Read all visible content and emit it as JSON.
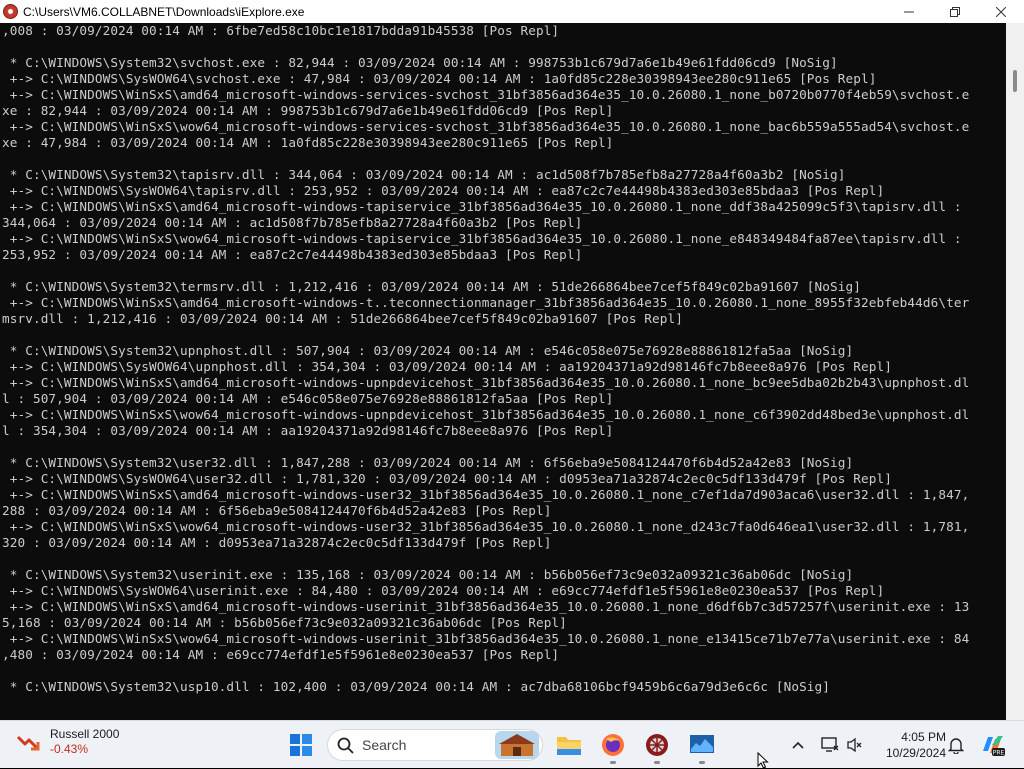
{
  "window": {
    "title": "C:\\Users\\VM6.COLLABNET\\Downloads\\iExplore.exe",
    "icons": {
      "app": "app-icon",
      "minimize": "minimize-icon",
      "maximize": "maximize-icon",
      "close": "close-icon"
    }
  },
  "console": {
    "lines": [
      ",008 : 03/09/2024 00:14 AM : 6fbe7ed58c10bc1e1817bdda91b45538 [Pos Repl]",
      "",
      " * C:\\WINDOWS\\System32\\svchost.exe : 82,944 : 03/09/2024 00:14 AM : 998753b1c679d7a6e1b49e61fdd06cd9 [NoSig]",
      " +-> C:\\WINDOWS\\SysWOW64\\svchost.exe : 47,984 : 03/09/2024 00:14 AM : 1a0fd85c228e30398943ee280c911e65 [Pos Repl]",
      " +-> C:\\WINDOWS\\WinSxS\\amd64_microsoft-windows-services-svchost_31bf3856ad364e35_10.0.26080.1_none_b0720b0770f4eb59\\svchost.e",
      "xe : 82,944 : 03/09/2024 00:14 AM : 998753b1c679d7a6e1b49e61fdd06cd9 [Pos Repl]",
      " +-> C:\\WINDOWS\\WinSxS\\wow64_microsoft-windows-services-svchost_31bf3856ad364e35_10.0.26080.1_none_bac6b559a555ad54\\svchost.e",
      "xe : 47,984 : 03/09/2024 00:14 AM : 1a0fd85c228e30398943ee280c911e65 [Pos Repl]",
      "",
      " * C:\\WINDOWS\\System32\\tapisrv.dll : 344,064 : 03/09/2024 00:14 AM : ac1d508f7b785efb8a27728a4f60a3b2 [NoSig]",
      " +-> C:\\WINDOWS\\SysWOW64\\tapisrv.dll : 253,952 : 03/09/2024 00:14 AM : ea87c2c7e44498b4383ed303e85bdaa3 [Pos Repl]",
      " +-> C:\\WINDOWS\\WinSxS\\amd64_microsoft-windows-tapiservice_31bf3856ad364e35_10.0.26080.1_none_ddf38a425099c5f3\\tapisrv.dll :",
      "344,064 : 03/09/2024 00:14 AM : ac1d508f7b785efb8a27728a4f60a3b2 [Pos Repl]",
      " +-> C:\\WINDOWS\\WinSxS\\wow64_microsoft-windows-tapiservice_31bf3856ad364e35_10.0.26080.1_none_e848349484fa87ee\\tapisrv.dll :",
      "253,952 : 03/09/2024 00:14 AM : ea87c2c7e44498b4383ed303e85bdaa3 [Pos Repl]",
      "",
      " * C:\\WINDOWS\\System32\\termsrv.dll : 1,212,416 : 03/09/2024 00:14 AM : 51de266864bee7cef5f849c02ba91607 [NoSig]",
      " +-> C:\\WINDOWS\\WinSxS\\amd64_microsoft-windows-t..teconnectionmanager_31bf3856ad364e35_10.0.26080.1_none_8955f32ebfeb44d6\\ter",
      "msrv.dll : 1,212,416 : 03/09/2024 00:14 AM : 51de266864bee7cef5f849c02ba91607 [Pos Repl]",
      "",
      " * C:\\WINDOWS\\System32\\upnphost.dll : 507,904 : 03/09/2024 00:14 AM : e546c058e075e76928e88861812fa5aa [NoSig]",
      " +-> C:\\WINDOWS\\SysWOW64\\upnphost.dll : 354,304 : 03/09/2024 00:14 AM : aa19204371a92d98146fc7b8eee8a976 [Pos Repl]",
      " +-> C:\\WINDOWS\\WinSxS\\amd64_microsoft-windows-upnpdevicehost_31bf3856ad364e35_10.0.26080.1_none_bc9ee5dba02b2b43\\upnphost.dl",
      "l : 507,904 : 03/09/2024 00:14 AM : e546c058e075e76928e88861812fa5aa [Pos Repl]",
      " +-> C:\\WINDOWS\\WinSxS\\wow64_microsoft-windows-upnpdevicehost_31bf3856ad364e35_10.0.26080.1_none_c6f3902dd48bed3e\\upnphost.dl",
      "l : 354,304 : 03/09/2024 00:14 AM : aa19204371a92d98146fc7b8eee8a976 [Pos Repl]",
      "",
      " * C:\\WINDOWS\\System32\\user32.dll : 1,847,288 : 03/09/2024 00:14 AM : 6f56eba9e5084124470f6b4d52a42e83 [NoSig]",
      " +-> C:\\WINDOWS\\SysWOW64\\user32.dll : 1,781,320 : 03/09/2024 00:14 AM : d0953ea71a32874c2ec0c5df133d479f [Pos Repl]",
      " +-> C:\\WINDOWS\\WinSxS\\amd64_microsoft-windows-user32_31bf3856ad364e35_10.0.26080.1_none_c7ef1da7d903aca6\\user32.dll : 1,847,",
      "288 : 03/09/2024 00:14 AM : 6f56eba9e5084124470f6b4d52a42e83 [Pos Repl]",
      " +-> C:\\WINDOWS\\WinSxS\\wow64_microsoft-windows-user32_31bf3856ad364e35_10.0.26080.1_none_d243c7fa0d646ea1\\user32.dll : 1,781,",
      "320 : 03/09/2024 00:14 AM : d0953ea71a32874c2ec0c5df133d479f [Pos Repl]",
      "",
      " * C:\\WINDOWS\\System32\\userinit.exe : 135,168 : 03/09/2024 00:14 AM : b56b056ef73c9e032a09321c36ab06dc [NoSig]",
      " +-> C:\\WINDOWS\\SysWOW64\\userinit.exe : 84,480 : 03/09/2024 00:14 AM : e69cc774efdf1e5f5961e8e0230ea537 [Pos Repl]",
      " +-> C:\\WINDOWS\\WinSxS\\amd64_microsoft-windows-userinit_31bf3856ad364e35_10.0.26080.1_none_d6df6b7c3d57257f\\userinit.exe : 13",
      "5,168 : 03/09/2024 00:14 AM : b56b056ef73c9e032a09321c36ab06dc [Pos Repl]",
      " +-> C:\\WINDOWS\\WinSxS\\wow64_microsoft-windows-userinit_31bf3856ad364e35_10.0.26080.1_none_e13415ce71b7e77a\\userinit.exe : 84",
      ",480 : 03/09/2024 00:14 AM : e69cc774efdf1e5f5961e8e0230ea537 [Pos Repl]",
      "",
      " * C:\\WINDOWS\\System32\\usp10.dll : 102,400 : 03/09/2024 00:14 AM : ac7dba68106bcf9459b6c6a79d3e6c6c [NoSig]"
    ],
    "colors": {
      "background": "#0c0c0c",
      "text": "#cccccc"
    }
  },
  "taskbar": {
    "widget": {
      "name": "Russell 2000",
      "change": "-0.43%",
      "icon": "stock-down-icon"
    },
    "search_placeholder": "Search",
    "apps": [
      "start-icon",
      "search-icon",
      "file-explorer-icon",
      "firefox-icon",
      "iexplore-icon",
      "monitor-app-icon"
    ],
    "tray": [
      "chevron-up-icon",
      "network-icon",
      "volume-icon",
      "notification-bell-icon",
      "copilot-icon"
    ],
    "clock": {
      "time": "4:05 PM",
      "date": "10/29/2024"
    },
    "colors": {
      "background": "#eef1f6",
      "negative": "#c42b1c"
    }
  }
}
